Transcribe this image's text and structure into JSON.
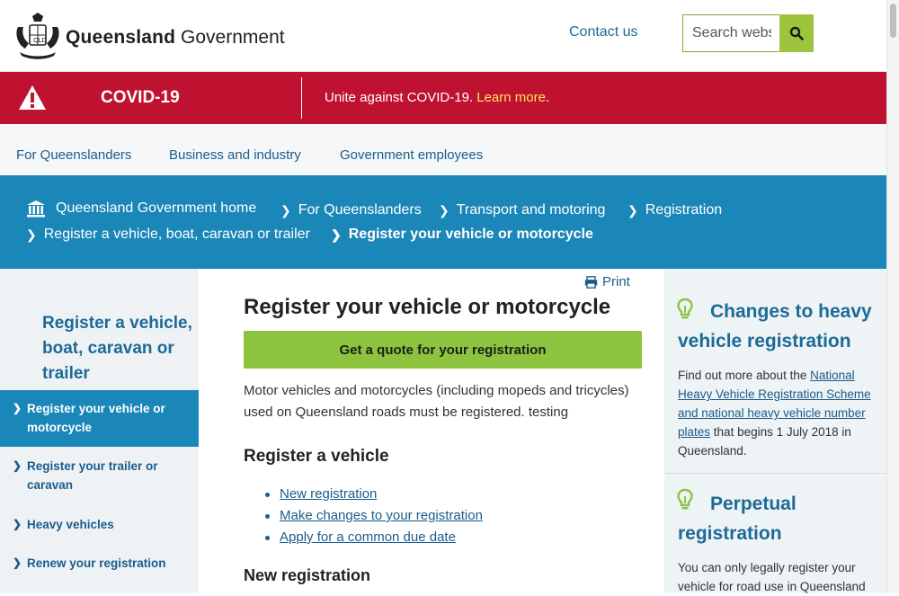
{
  "header": {
    "brand_bold": "Queensland",
    "brand_rest": "Government",
    "contact": "Contact us",
    "search_placeholder": "Search website"
  },
  "covid": {
    "title": "COVID-19",
    "message": "Unite against COVID-19.",
    "link": "Learn more",
    "after": "."
  },
  "topnav": [
    "For Queenslanders",
    "Business and industry",
    "Government employees"
  ],
  "breadcrumb": {
    "home": "Queensland Government home",
    "items": [
      "For Queenslanders",
      "Transport and motoring",
      "Registration",
      "Register a vehicle, boat, caravan or trailer"
    ],
    "current": "Register your vehicle or motorcycle"
  },
  "sidebar": {
    "heading": "Register a vehicle, boat, caravan or trailer",
    "items": [
      {
        "label": "Register your vehicle or motorcycle",
        "active": true
      },
      {
        "label": "Register your trailer or caravan",
        "active": false
      },
      {
        "label": "Heavy vehicles",
        "active": false
      },
      {
        "label": "Renew your registration",
        "active": false
      }
    ]
  },
  "main": {
    "print": "Print",
    "title": "Register your vehicle or motorcycle",
    "quote_button": "Get a quote for your registration",
    "intro": "Motor vehicles and motorcycles (including mopeds and tricycles) used on Queensland roads must be registered. testing",
    "section_title": "Register a vehicle",
    "links": [
      "New registration",
      "Make changes to your registration",
      "Apply for a common due date"
    ],
    "next_section": "New registration"
  },
  "aside": {
    "cards": [
      {
        "title": "Changes to heavy vehicle registration",
        "text_before": "Find out more about the",
        "link": "National Heavy Vehicle Registration Scheme and national heavy vehicle number plates",
        "text_after": "that begins 1 July 2018 in Queensland."
      },
      {
        "title": "Perpetual registration",
        "text_before": "You can only legally register your vehicle for road use in Queensland"
      }
    ]
  },
  "colors": {
    "covid_red": "#bf1230",
    "breadcrumb_blue": "#1b86b8",
    "button_green": "#8cc43f",
    "link_blue": "#1c5c8a"
  }
}
